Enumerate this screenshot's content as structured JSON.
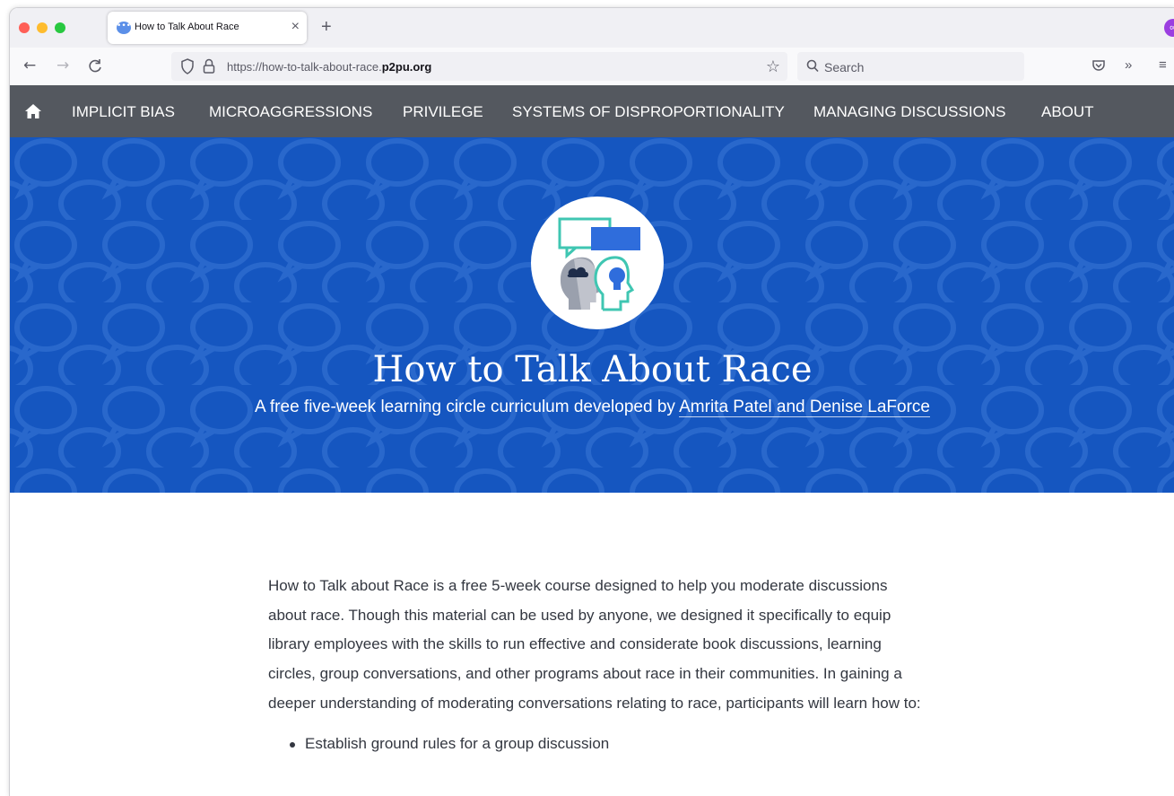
{
  "browser": {
    "tab": {
      "title": "How to Talk About Race",
      "close_glyph": "×"
    },
    "new_tab_glyph": "+",
    "account_initial": "∞",
    "nav": {
      "back": "←",
      "forward": "→",
      "reload": "C"
    },
    "url": {
      "prefix": "https://how-to-talk-about-race.",
      "domain": "p2pu.org"
    },
    "search_placeholder": "Search",
    "overflow_glyph": "»",
    "menu_glyph": "≡",
    "star_glyph": "☆"
  },
  "site_nav": {
    "items": [
      {
        "label": "IMPLICIT BIAS"
      },
      {
        "label": "MICROAGGRESSIONS"
      },
      {
        "label": "PRIVILEGE"
      },
      {
        "label": "SYSTEMS OF DISPROPORTIONALITY"
      },
      {
        "label": "MANAGING DISCUSSIONS"
      },
      {
        "label": "ABOUT"
      }
    ]
  },
  "hero": {
    "title": "How to Talk About Race",
    "subtitle_prefix": "A free five-week learning circle curriculum developed by ",
    "authors": "Amrita Patel and Denise LaForce"
  },
  "content": {
    "intro": "How to Talk about Race is a free 5-week course designed to help you moderate discussions about race. Though this material can be used by anyone, we designed it specifically to equip library employees with the skills to run effective and considerate book discussions, learning circles, group conversations, and other programs about race in their communities. In gaining a deeper understanding of moderating conversations relating to race, participants will learn how to:",
    "list": [
      "Establish ground rules for a group discussion"
    ]
  },
  "colors": {
    "nav_bg": "#54585f",
    "hero_bg": "#1556c0",
    "pattern": "#3a76d6"
  }
}
